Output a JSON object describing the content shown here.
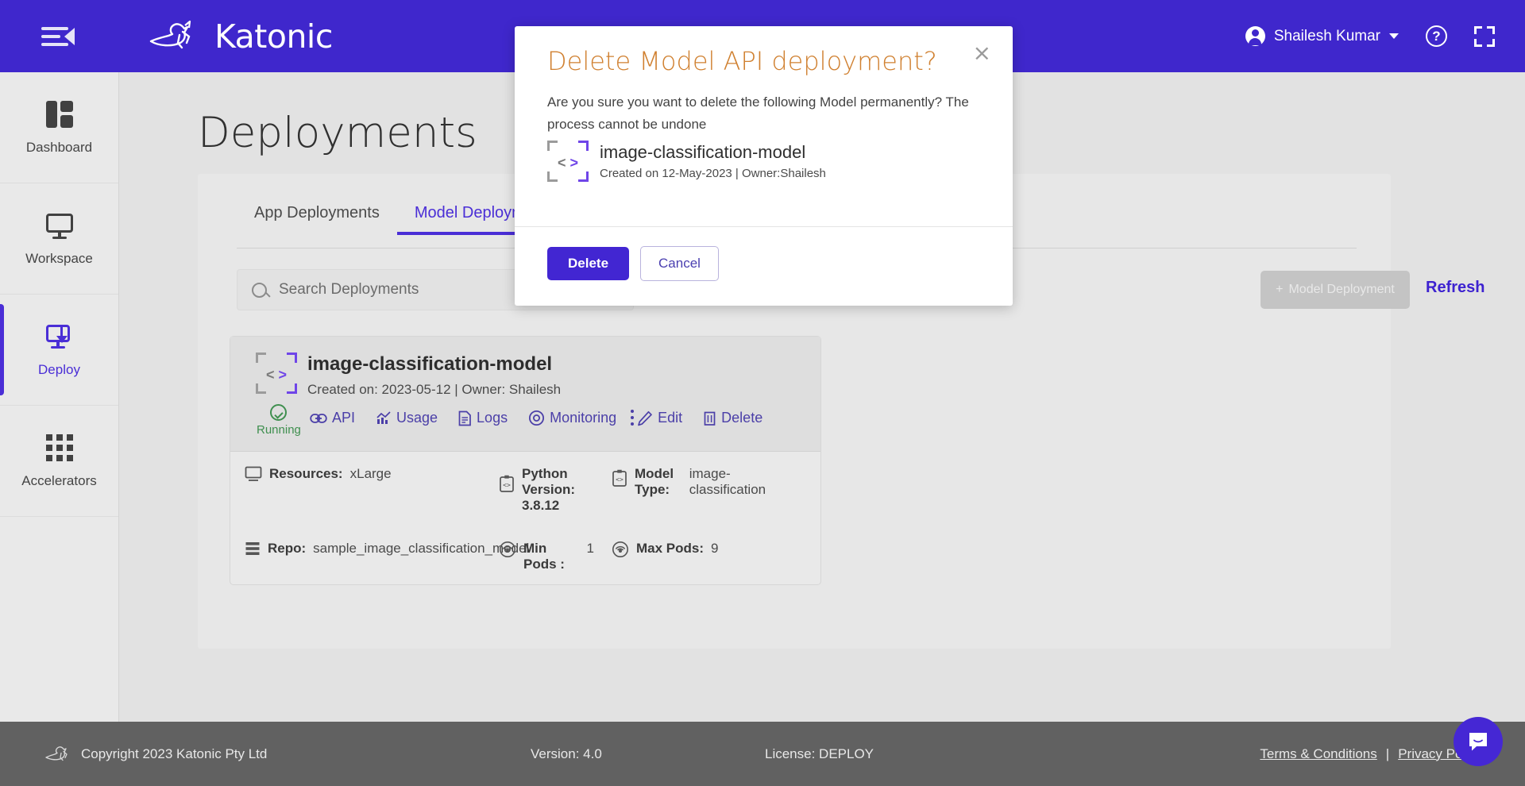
{
  "header": {
    "menu_icon": "hamburger-collapse-icon",
    "brand": "Katonic",
    "user_name": "Shailesh Kumar",
    "help_glyph": "?",
    "help_icon": "help-icon",
    "fullscreen_icon": "fullscreen-icon"
  },
  "sidebar": {
    "items": [
      {
        "label": "Dashboard",
        "icon": "dashboard-icon",
        "active": false
      },
      {
        "label": "Workspace",
        "icon": "monitor-icon",
        "active": false
      },
      {
        "label": "Deploy",
        "icon": "deploy-icon",
        "active": true
      },
      {
        "label": "Accelerators",
        "icon": "grid-icon",
        "active": false
      }
    ]
  },
  "main": {
    "page_title": "Deployments",
    "tabs": [
      {
        "label": "App Deployments",
        "active": false
      },
      {
        "label": "Model Deployments",
        "active": true
      }
    ],
    "search": {
      "placeholder": "Search Deployments",
      "value": ""
    },
    "new_deployment_button": "Model Deployment",
    "new_deployment_plus": "+",
    "refresh_link": "Refresh"
  },
  "deployment_card": {
    "icon": "code-brackets-icon",
    "name": "image-classification-model",
    "subtitle": "Created on: 2023-05-12 | Owner: Shailesh",
    "status": "Running",
    "status_icon": "check-circle-icon",
    "actions": [
      {
        "label": "API",
        "icon": "link-icon"
      },
      {
        "label": "Usage",
        "icon": "chart-icon"
      },
      {
        "label": "Logs",
        "icon": "document-icon"
      },
      {
        "label": "Monitoring",
        "icon": "eye-icon"
      },
      {
        "label": "Edit",
        "icon": "pencil-icon"
      },
      {
        "label": "Delete",
        "icon": "trash-icon"
      }
    ],
    "more_icon": "kebab-menu-icon",
    "meta": [
      {
        "icon": "monitor-icon",
        "label": "Resources:",
        "value": "xLarge"
      },
      {
        "icon": "code-chip-icon",
        "label": "Python Version:",
        "value": "3.8.12"
      },
      {
        "icon": "code-chip-icon",
        "label": "Model Type:",
        "value": "image-classification"
      },
      {
        "icon": "database-icon",
        "label": "Repo:",
        "value": "sample_image_classification_model"
      },
      {
        "icon": "pods-icon",
        "label": "Min Pods :",
        "value": "1"
      },
      {
        "icon": "pods-icon",
        "label": "Max Pods:",
        "value": "9"
      }
    ]
  },
  "modal": {
    "title": "Delete Model API deployment?",
    "close_glyph": "×",
    "description": "Are you sure you want to delete the following Model permanently? The process cannot be undone",
    "item_icon": "code-brackets-icon",
    "item_name": "image-classification-model",
    "item_sub": "Created on 12-May-2023 | Owner:Shailesh",
    "confirm_label": "Delete",
    "cancel_label": "Cancel"
  },
  "footer": {
    "copyright": "Copyright 2023 Katonic Pty Ltd",
    "version": "Version: 4.0",
    "license": "License: DEPLOY",
    "terms": "Terms & Conditions",
    "separator": "|",
    "privacy": "Privacy Policy",
    "chat_icon": "chat-bubble-icon"
  },
  "colors": {
    "brand_purple": "#3f27cc",
    "accent_purple": "#4a2ed6",
    "modal_title_orange": "#d08030",
    "status_green": "#3f8f4f",
    "footer_gray": "#616161"
  }
}
